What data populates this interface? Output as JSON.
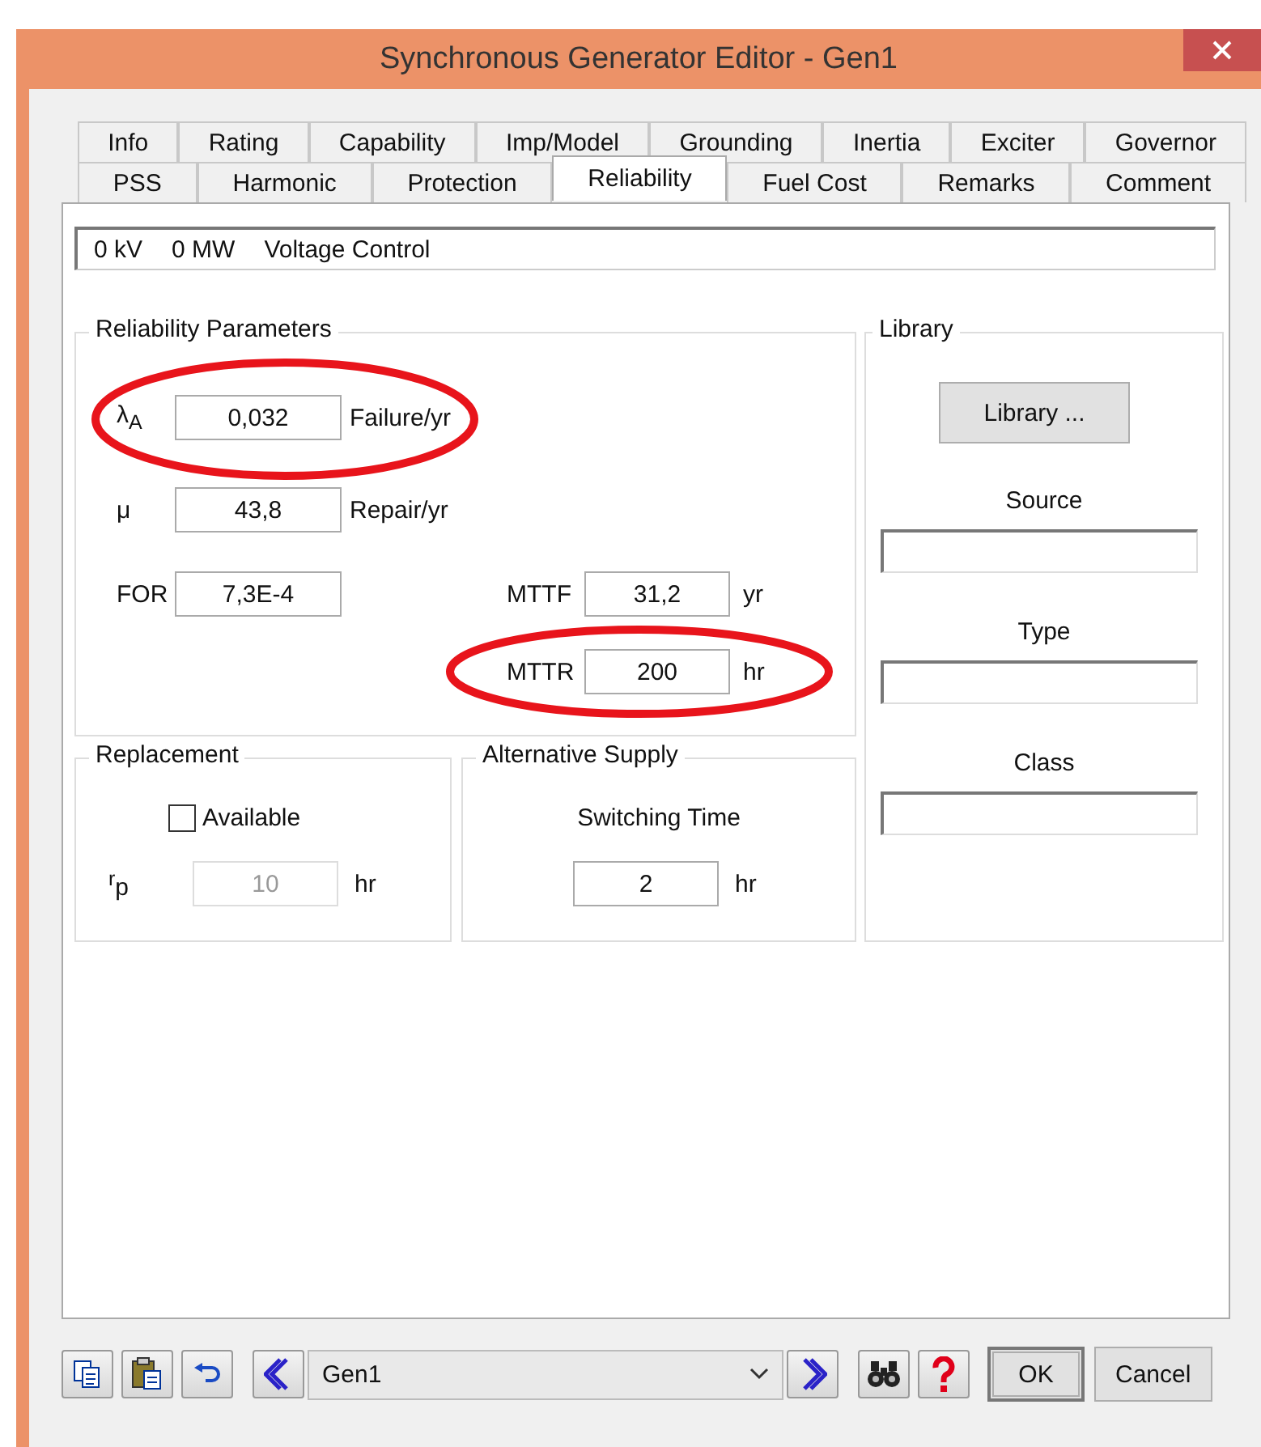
{
  "window": {
    "title": "Synchronous Generator Editor - Gen1"
  },
  "tabs_row1": [
    {
      "label": "Info",
      "selected": false
    },
    {
      "label": "Rating",
      "selected": false
    },
    {
      "label": "Capability",
      "selected": false
    },
    {
      "label": "Imp/Model",
      "selected": false
    },
    {
      "label": "Grounding",
      "selected": false
    },
    {
      "label": "Inertia",
      "selected": false
    },
    {
      "label": "Exciter",
      "selected": false
    },
    {
      "label": "Governor",
      "selected": false
    }
  ],
  "tabs_row2": [
    {
      "label": "PSS",
      "selected": false
    },
    {
      "label": "Harmonic",
      "selected": false
    },
    {
      "label": "Protection",
      "selected": false
    },
    {
      "label": "Reliability",
      "selected": true
    },
    {
      "label": "Fuel Cost",
      "selected": false
    },
    {
      "label": "Remarks",
      "selected": false
    },
    {
      "label": "Comment",
      "selected": false
    }
  ],
  "info_bar": [
    "0 kV",
    "0 MW",
    "Voltage Control"
  ],
  "reliability": {
    "title": "Reliability Parameters",
    "rows": [
      {
        "symbol": "λ$_{A}$",
        "value": "0,032",
        "unit": "Failure/yr",
        "circled": true
      },
      {
        "symbol": "μ",
        "value": "43,8",
        "unit": "Repair/yr",
        "circled": false
      },
      {
        "symbol": "FOR",
        "value": "7,3E-4",
        "circled": false
      }
    ],
    "mttf": {
      "label": "MTTF",
      "value": "31,2",
      "unit": "yr",
      "circled": false
    },
    "mttr": {
      "label": "MTTR",
      "value": "200",
      "unit": "hr",
      "circled": true
    }
  },
  "replacement": {
    "title": "Replacement",
    "available": {
      "label": "Available",
      "checked": false
    },
    "rp": {
      "symbol": "$^{r}$p",
      "value": "10",
      "unit": "hr",
      "disabled": true
    }
  },
  "alternative_supply": {
    "title": "Alternative Supply",
    "label": "Switching Time",
    "value": "2",
    "unit": "hr"
  },
  "library": {
    "title": "Library",
    "button": "Library ...",
    "fields": [
      {
        "label": "Source"
      },
      {
        "label": "Type"
      },
      {
        "label": "Class"
      }
    ]
  },
  "footer": {
    "selector": "Gen1",
    "buttons": [
      "OK",
      "Cancel"
    ]
  }
}
